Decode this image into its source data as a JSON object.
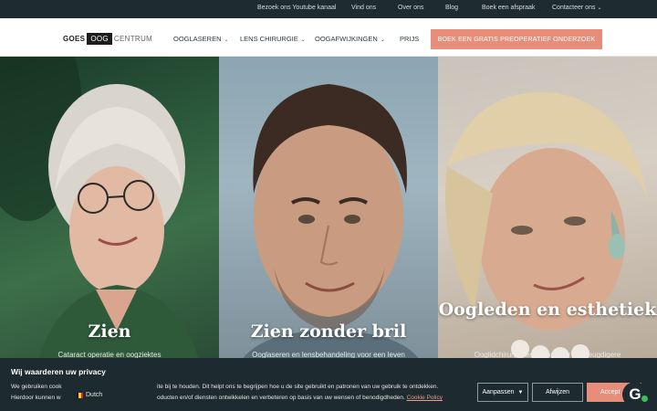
{
  "topbar": {
    "links": [
      "Bezoek ons Youtube kanaal",
      "Vind ons",
      "Over ons",
      "Blog",
      "Boek een afspraak",
      "Contacteer ons"
    ]
  },
  "header": {
    "logo": {
      "left": "GOES",
      "middle": "OOG",
      "right": "CENTRUM"
    },
    "nav": [
      "OOGLASEREN",
      "LENS CHIRURGIE",
      "OOGAFWIJKINGEN",
      "PRIJS"
    ],
    "cta": "BOEK EEN GRATIS PREOPERATIEF ONDERZOEK"
  },
  "hero": {
    "panels": [
      {
        "title": "Zien",
        "subtitle": "Cataract operatie en oogziektes"
      },
      {
        "title": "Zien zonder bril",
        "subtitle": "Ooglaseren en lensbehandeling voor een leven"
      },
      {
        "title": "Oogleden en esthetiek",
        "subtitle": "Ooglidchirurgie en Botox voor een jeugdigere"
      }
    ]
  },
  "cookie": {
    "title": "Wij waarderen uw privacy",
    "line1_left": "We gebruiken cook",
    "line1_right": "ite bij te houden. Dit helpt ons te begrijpen hoe u de site gebruikt en patronen van uw gebruik te ontdekken.",
    "line2_left": "Hierdoor kunnen w",
    "line2_right": "oducten en/of diensten ontwikkelen en verbeteren op basis van uw wensen of benodigdheden.",
    "link": "Cookie Policy",
    "language": "Dutch",
    "buttons": {
      "customize": "Aanpassen",
      "reject": "Afwijzen",
      "accept": "Accept"
    }
  },
  "badge": {
    "letter": "G"
  },
  "colors": {
    "topbar": "#1e2b30",
    "accent": "#e98d7b",
    "cookie_bg": "#1d2a30"
  }
}
